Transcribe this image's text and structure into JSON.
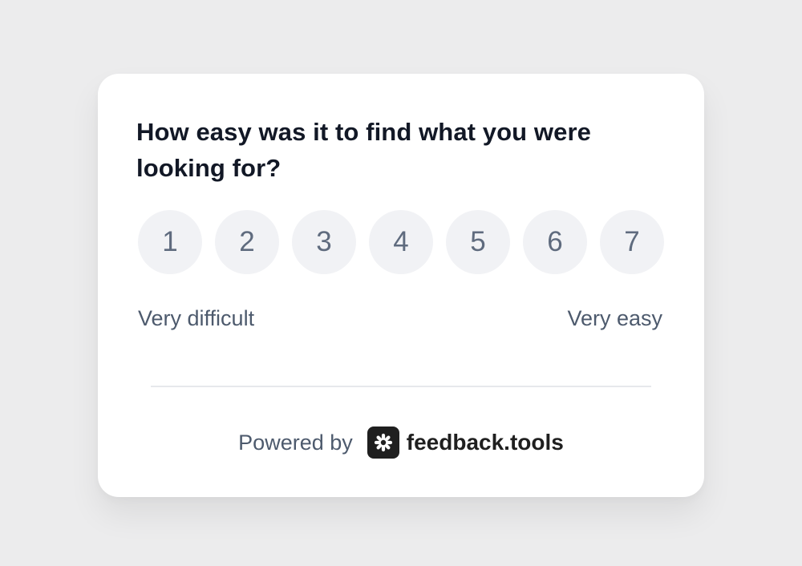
{
  "survey": {
    "question": "How easy was it to find what you were looking for?",
    "scale": [
      "1",
      "2",
      "3",
      "4",
      "5",
      "6",
      "7"
    ],
    "min_label": "Very difficult",
    "max_label": "Very easy"
  },
  "footer": {
    "powered_by": "Powered by",
    "brand_name": "feedback.tools",
    "brand_icon": "asterisk-logo-icon"
  },
  "colors": {
    "background": "#ececed",
    "card": "#ffffff",
    "question_text": "#121826",
    "scale_button_bg": "#f1f2f5",
    "scale_button_text": "#5f6b7e",
    "muted_text": "#4d5a6d",
    "brand": "#1f1f1f"
  }
}
